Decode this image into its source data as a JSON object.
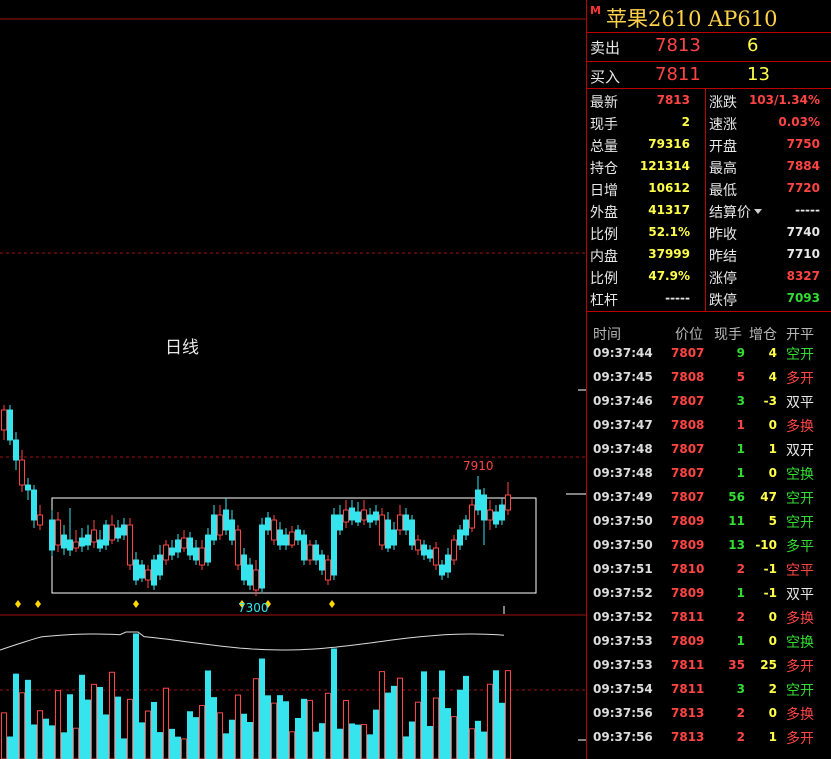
{
  "chart": {
    "period_label": "日线",
    "high_label": "7910",
    "low_label": "7300",
    "colors": {
      "up": "#ff4444",
      "down": "#35e4ec",
      "grid": "#a01010",
      "box": "#ffffff",
      "ma": "#dcdcdc",
      "marker": "#ffd700"
    }
  },
  "panel": {
    "badge": "M",
    "title": "苹果2610  AP610",
    "sell": {
      "label": "卖出",
      "price": "7813",
      "volume": "6"
    },
    "buy": {
      "label": "买入",
      "price": "7811",
      "volume": "13"
    },
    "quote_rows": [
      {
        "l": "最新",
        "lv": "7813",
        "lc": "red",
        "r": "涨跌",
        "rv": "103/1.34%",
        "rc": "red"
      },
      {
        "l": "现手",
        "lv": "2",
        "lc": "yellow",
        "r": "速涨",
        "rv": "0.03%",
        "rc": "red"
      },
      {
        "l": "总量",
        "lv": "79316",
        "lc": "yellow",
        "r": "开盘",
        "rv": "7750",
        "rc": "red"
      },
      {
        "l": "持仓",
        "lv": "121314",
        "lc": "yellow",
        "r": "最高",
        "rv": "7884",
        "rc": "red"
      },
      {
        "l": "日增",
        "lv": "10612",
        "lc": "yellow",
        "r": "最低",
        "rv": "7720",
        "rc": "red"
      },
      {
        "l": "外盘",
        "lv": "41317",
        "lc": "yellow",
        "r": "结算价",
        "rv": "-----",
        "rc": "white",
        "dropdown": true
      },
      {
        "l": "比例",
        "lv": "52.1%",
        "lc": "yellow",
        "r": "昨收",
        "rv": "7740",
        "rc": "white"
      },
      {
        "l": "内盘",
        "lv": "37999",
        "lc": "yellow",
        "r": "昨结",
        "rv": "7710",
        "rc": "white"
      },
      {
        "l": "比例",
        "lv": "47.9%",
        "lc": "yellow",
        "r": "涨停",
        "rv": "8327",
        "rc": "red"
      },
      {
        "l": "杠杆",
        "lv": "-----",
        "lc": "white",
        "r": "跌停",
        "rv": "7093",
        "rc": "green"
      }
    ],
    "trade_headers": [
      "时间",
      "价位",
      "现手",
      "增仓",
      "开平"
    ],
    "trades": [
      {
        "time": "09:37:44",
        "price": "7807",
        "pc": "red",
        "vol": "9",
        "vc": "green",
        "oi": "4",
        "oc": "yellow",
        "type": "空开",
        "tc": "green"
      },
      {
        "time": "09:37:45",
        "price": "7808",
        "pc": "red",
        "vol": "5",
        "vc": "red",
        "oi": "4",
        "oc": "yellow",
        "type": "多开",
        "tc": "red"
      },
      {
        "time": "09:37:46",
        "price": "7807",
        "pc": "red",
        "vol": "3",
        "vc": "green",
        "oi": "-3",
        "oc": "yellow",
        "type": "双平",
        "tc": "white"
      },
      {
        "time": "09:37:47",
        "price": "7808",
        "pc": "red",
        "vol": "1",
        "vc": "red",
        "oi": "0",
        "oc": "yellow",
        "type": "多换",
        "tc": "red"
      },
      {
        "time": "09:37:48",
        "price": "7807",
        "pc": "red",
        "vol": "1",
        "vc": "green",
        "oi": "1",
        "oc": "yellow",
        "type": "双开",
        "tc": "white"
      },
      {
        "time": "09:37:48",
        "price": "7807",
        "pc": "red",
        "vol": "1",
        "vc": "green",
        "oi": "0",
        "oc": "yellow",
        "type": "空换",
        "tc": "green"
      },
      {
        "time": "09:37:49",
        "price": "7807",
        "pc": "red",
        "vol": "56",
        "vc": "green",
        "oi": "47",
        "oc": "yellow",
        "type": "空开",
        "tc": "green"
      },
      {
        "time": "09:37:50",
        "price": "7809",
        "pc": "red",
        "vol": "11",
        "vc": "green",
        "oi": "5",
        "oc": "yellow",
        "type": "空开",
        "tc": "green"
      },
      {
        "time": "09:37:50",
        "price": "7809",
        "pc": "red",
        "vol": "13",
        "vc": "green",
        "oi": "-10",
        "oc": "yellow",
        "type": "多平",
        "tc": "green"
      },
      {
        "time": "09:37:51",
        "price": "7810",
        "pc": "red",
        "vol": "2",
        "vc": "red",
        "oi": "-1",
        "oc": "yellow",
        "type": "空平",
        "tc": "red"
      },
      {
        "time": "09:37:52",
        "price": "7809",
        "pc": "red",
        "vol": "1",
        "vc": "green",
        "oi": "-1",
        "oc": "yellow",
        "type": "双平",
        "tc": "white"
      },
      {
        "time": "09:37:52",
        "price": "7811",
        "pc": "red",
        "vol": "2",
        "vc": "red",
        "oi": "0",
        "oc": "yellow",
        "type": "多换",
        "tc": "red"
      },
      {
        "time": "09:37:53",
        "price": "7809",
        "pc": "red",
        "vol": "1",
        "vc": "green",
        "oi": "0",
        "oc": "yellow",
        "type": "空换",
        "tc": "green"
      },
      {
        "time": "09:37:53",
        "price": "7811",
        "pc": "red",
        "vol": "35",
        "vc": "red",
        "oi": "25",
        "oc": "yellow",
        "type": "多开",
        "tc": "red"
      },
      {
        "time": "09:37:54",
        "price": "7811",
        "pc": "red",
        "vol": "3",
        "vc": "green",
        "oi": "2",
        "oc": "yellow",
        "type": "空开",
        "tc": "green"
      },
      {
        "time": "09:37:56",
        "price": "7813",
        "pc": "red",
        "vol": "2",
        "vc": "red",
        "oi": "0",
        "oc": "yellow",
        "type": "多换",
        "tc": "red"
      },
      {
        "time": "09:37:56",
        "price": "7813",
        "pc": "red",
        "vol": "2",
        "vc": "red",
        "oi": "1",
        "oc": "yellow",
        "type": "多开",
        "tc": "red"
      }
    ]
  }
}
